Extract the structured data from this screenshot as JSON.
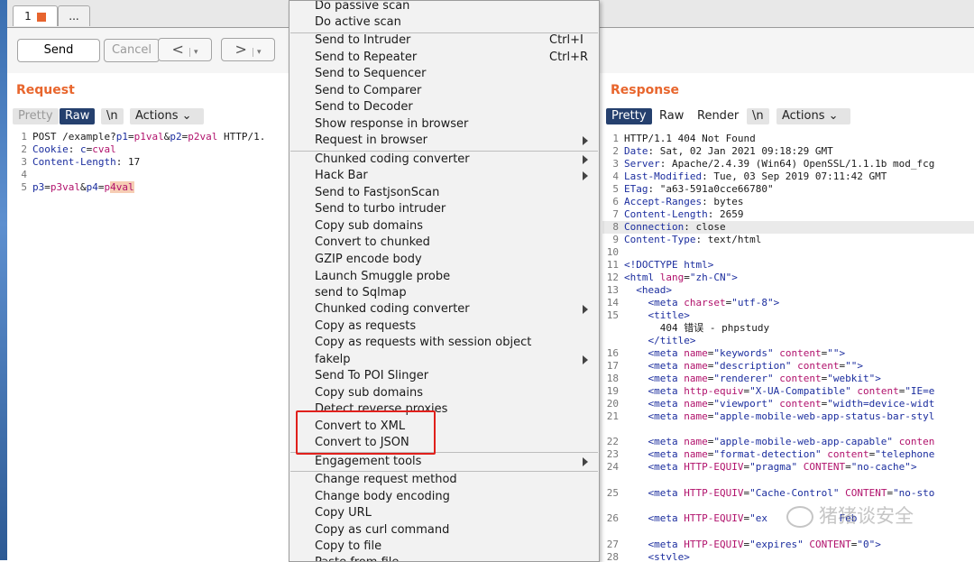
{
  "tabs": {
    "active": "1",
    "more": "..."
  },
  "toolbar": {
    "send": "Send",
    "cancel": "Cancel",
    "back": "<",
    "forward": ">",
    "dropdown": "▾"
  },
  "request": {
    "title": "Request",
    "views": [
      "Pretty",
      "Raw",
      "\\n"
    ],
    "actions": "Actions",
    "lines": [
      {
        "n": "1",
        "parts": [
          [
            "",
            "POST /example?"
          ],
          [
            "kw",
            "p1"
          ],
          [
            "",
            "="
          ],
          [
            "val",
            "p1val"
          ],
          [
            "",
            "&"
          ],
          [
            "kw",
            "p2"
          ],
          [
            "",
            "="
          ],
          [
            "val",
            "p2val"
          ],
          [
            "",
            " HTTP/1."
          ]
        ]
      },
      {
        "n": "2",
        "parts": [
          [
            "kw",
            "Cookie"
          ],
          [
            "",
            ": "
          ],
          [
            "kw",
            "c"
          ],
          [
            "",
            "="
          ],
          [
            "val",
            "cval"
          ]
        ]
      },
      {
        "n": "3",
        "parts": [
          [
            "kw",
            "Content-Length"
          ],
          [
            "",
            ": 17"
          ]
        ]
      },
      {
        "n": "4",
        "parts": []
      },
      {
        "n": "5",
        "parts": [
          [
            "kw",
            "p3"
          ],
          [
            "",
            "="
          ],
          [
            "val",
            "p3val"
          ],
          [
            "",
            "&"
          ],
          [
            "kw",
            "p4"
          ],
          [
            "",
            "="
          ],
          [
            "val",
            "p"
          ],
          [
            "val hl",
            "4val"
          ]
        ]
      }
    ]
  },
  "response": {
    "title": "Response",
    "views": [
      "Pretty",
      "Raw",
      "Render",
      "\\n"
    ],
    "actions": "Actions",
    "lines": [
      {
        "n": "1",
        "t": 147,
        "parts": [
          [
            "",
            "HTTP/1.1 404 Not Found"
          ]
        ]
      },
      {
        "n": "2",
        "t": 161,
        "parts": [
          [
            "kw",
            "Date"
          ],
          [
            "",
            ": Sat, 02 Jan 2021 09:18:29 GMT"
          ]
        ]
      },
      {
        "n": "3",
        "t": 175,
        "parts": [
          [
            "kw",
            "Server"
          ],
          [
            "",
            ": Apache/2.4.39 (Win64) OpenSSL/1.1.1b mod_fcg"
          ]
        ]
      },
      {
        "n": "4",
        "t": 189,
        "parts": [
          [
            "kw",
            "Last-Modified"
          ],
          [
            "",
            ": Tue, 03 Sep 2019 07:11:42 GMT"
          ]
        ]
      },
      {
        "n": "5",
        "t": 203,
        "parts": [
          [
            "kw",
            "ETag"
          ],
          [
            "",
            ": \"a63-591a0cce66780\""
          ]
        ]
      },
      {
        "n": "6",
        "t": 217,
        "parts": [
          [
            "kw",
            "Accept-Ranges"
          ],
          [
            "",
            ": bytes"
          ]
        ]
      },
      {
        "n": "7",
        "t": 231,
        "parts": [
          [
            "kw",
            "Content-Length"
          ],
          [
            "",
            ": 2659"
          ]
        ]
      },
      {
        "n": "8",
        "t": 245,
        "parts": [
          [
            "kw",
            "Connection"
          ],
          [
            "",
            ": close"
          ]
        ]
      },
      {
        "n": "9",
        "t": 259,
        "parts": [
          [
            "kw",
            "Content-Type"
          ],
          [
            "",
            ": text/html"
          ]
        ]
      },
      {
        "n": "10",
        "t": 273,
        "parts": []
      },
      {
        "n": "11",
        "t": 287,
        "parts": [
          [
            "tag",
            "<!DOCTYPE html>"
          ]
        ]
      },
      {
        "n": "12",
        "t": 301,
        "parts": [
          [
            "tag",
            "<html "
          ],
          [
            "attr",
            "lang"
          ],
          [
            "",
            "="
          ],
          [
            "str",
            "\"zh-CN\""
          ],
          [
            "tag",
            ">"
          ]
        ]
      },
      {
        "n": "13",
        "t": 315,
        "parts": [
          [
            "",
            "  "
          ],
          [
            "tag",
            "<head>"
          ]
        ]
      },
      {
        "n": "14",
        "t": 329,
        "parts": [
          [
            "",
            "    "
          ],
          [
            "tag",
            "<meta "
          ],
          [
            "attr",
            "charset"
          ],
          [
            "",
            "="
          ],
          [
            "str",
            "\"utf-8\""
          ],
          [
            "tag",
            ">"
          ]
        ]
      },
      {
        "n": "15",
        "t": 343,
        "parts": [
          [
            "",
            "    "
          ],
          [
            "tag",
            "<title>"
          ]
        ]
      },
      {
        "n": "",
        "t": 357,
        "parts": [
          [
            "",
            "      404 错误 - phpstudy"
          ]
        ]
      },
      {
        "n": "",
        "t": 371,
        "parts": [
          [
            "",
            "    "
          ],
          [
            "tag",
            "</title>"
          ]
        ]
      },
      {
        "n": "16",
        "t": 385,
        "parts": [
          [
            "",
            "    "
          ],
          [
            "tag",
            "<meta "
          ],
          [
            "attr",
            "name"
          ],
          [
            "",
            "="
          ],
          [
            "str",
            "\"keywords\""
          ],
          [
            "",
            " "
          ],
          [
            "attr",
            "content"
          ],
          [
            "",
            "="
          ],
          [
            "str",
            "\"\""
          ],
          [
            "tag",
            ">"
          ]
        ]
      },
      {
        "n": "17",
        "t": 399,
        "parts": [
          [
            "",
            "    "
          ],
          [
            "tag",
            "<meta "
          ],
          [
            "attr",
            "name"
          ],
          [
            "",
            "="
          ],
          [
            "str",
            "\"description\""
          ],
          [
            "",
            " "
          ],
          [
            "attr",
            "content"
          ],
          [
            "",
            "="
          ],
          [
            "str",
            "\"\""
          ],
          [
            "tag",
            ">"
          ]
        ]
      },
      {
        "n": "18",
        "t": 413,
        "parts": [
          [
            "",
            "    "
          ],
          [
            "tag",
            "<meta "
          ],
          [
            "attr",
            "name"
          ],
          [
            "",
            "="
          ],
          [
            "str",
            "\"renderer\""
          ],
          [
            "",
            " "
          ],
          [
            "attr",
            "content"
          ],
          [
            "",
            "="
          ],
          [
            "str",
            "\"webkit\""
          ],
          [
            "tag",
            ">"
          ]
        ]
      },
      {
        "n": "19",
        "t": 427,
        "parts": [
          [
            "",
            "    "
          ],
          [
            "tag",
            "<meta "
          ],
          [
            "attr",
            "http-equiv"
          ],
          [
            "",
            "="
          ],
          [
            "str",
            "\"X-UA-Compatible\""
          ],
          [
            "",
            " "
          ],
          [
            "attr",
            "content"
          ],
          [
            "",
            "="
          ],
          [
            "str",
            "\"IE=e"
          ]
        ]
      },
      {
        "n": "20",
        "t": 441,
        "parts": [
          [
            "",
            "    "
          ],
          [
            "tag",
            "<meta "
          ],
          [
            "attr",
            "name"
          ],
          [
            "",
            "="
          ],
          [
            "str",
            "\"viewport\""
          ],
          [
            "",
            " "
          ],
          [
            "attr",
            "content"
          ],
          [
            "",
            "="
          ],
          [
            "str",
            "\"width=device-widt"
          ]
        ]
      },
      {
        "n": "21",
        "t": 455,
        "parts": [
          [
            "",
            "    "
          ],
          [
            "tag",
            "<meta "
          ],
          [
            "attr",
            "name"
          ],
          [
            "",
            "="
          ],
          [
            "str",
            "\"apple-mobile-web-app-status-bar-styl"
          ]
        ]
      },
      {
        "n": "22",
        "t": 483,
        "parts": [
          [
            "",
            "    "
          ],
          [
            "tag",
            "<meta "
          ],
          [
            "attr",
            "name"
          ],
          [
            "",
            "="
          ],
          [
            "str",
            "\"apple-mobile-web-app-capable\""
          ],
          [
            "",
            " "
          ],
          [
            "attr",
            "conten"
          ]
        ]
      },
      {
        "n": "23",
        "t": 497,
        "parts": [
          [
            "",
            "    "
          ],
          [
            "tag",
            "<meta "
          ],
          [
            "attr",
            "name"
          ],
          [
            "",
            "="
          ],
          [
            "str",
            "\"format-detection\""
          ],
          [
            "",
            " "
          ],
          [
            "attr",
            "content"
          ],
          [
            "",
            "="
          ],
          [
            "str",
            "\"telephone"
          ]
        ]
      },
      {
        "n": "24",
        "t": 511,
        "parts": [
          [
            "",
            "    "
          ],
          [
            "tag",
            "<meta "
          ],
          [
            "attr",
            "HTTP-EQUIV"
          ],
          [
            "",
            "="
          ],
          [
            "str",
            "\"pragma\""
          ],
          [
            "",
            " "
          ],
          [
            "attr",
            "CONTENT"
          ],
          [
            "",
            "="
          ],
          [
            "str",
            "\"no-cache\""
          ],
          [
            "tag",
            ">"
          ]
        ]
      },
      {
        "n": "25",
        "t": 540,
        "parts": [
          [
            "",
            "    "
          ],
          [
            "tag",
            "<meta "
          ],
          [
            "attr",
            "HTTP-EQUIV"
          ],
          [
            "",
            "="
          ],
          [
            "str",
            "\"Cache-Control\""
          ],
          [
            "",
            " "
          ],
          [
            "attr",
            "CONTENT"
          ],
          [
            "",
            "="
          ],
          [
            "str",
            "\"no-sto"
          ]
        ]
      },
      {
        "n": "26",
        "t": 568,
        "parts": [
          [
            "",
            "    "
          ],
          [
            "tag",
            "<meta "
          ],
          [
            "attr",
            "HTTP-EQUIV"
          ],
          [
            "",
            "="
          ],
          [
            "str",
            "\"ex"
          ],
          [
            "",
            "            "
          ],
          [
            "str",
            "Feb"
          ]
        ]
      },
      {
        "n": "27",
        "t": 597,
        "parts": [
          [
            "",
            "    "
          ],
          [
            "tag",
            "<meta "
          ],
          [
            "attr",
            "HTTP-EQUIV"
          ],
          [
            "",
            "="
          ],
          [
            "str",
            "\"expires\""
          ],
          [
            "",
            " "
          ],
          [
            "attr",
            "CONTENT"
          ],
          [
            "",
            "="
          ],
          [
            "str",
            "\"0\""
          ],
          [
            "tag",
            ">"
          ]
        ]
      },
      {
        "n": "28",
        "t": 611,
        "parts": [
          [
            "",
            "    "
          ],
          [
            "tag",
            "<style>"
          ]
        ]
      }
    ]
  },
  "menu": {
    "items": [
      {
        "label": "Do passive scan",
        "t": -3
      },
      {
        "label": "Do active scan",
        "t": 15
      },
      {
        "sep": true,
        "t": 35
      },
      {
        "label": "Send to Intruder",
        "shortcut": "Ctrl+I",
        "t": 35
      },
      {
        "label": "Send to Repeater",
        "shortcut": "Ctrl+R",
        "t": 54
      },
      {
        "label": "Send to Sequencer",
        "t": 72
      },
      {
        "label": "Send to Comparer",
        "t": 91
      },
      {
        "label": "Send to Decoder",
        "t": 109
      },
      {
        "label": "Show response in browser",
        "t": 128
      },
      {
        "label": "Request in browser",
        "submenu": true,
        "t": 146
      },
      {
        "sep": true,
        "t": 166
      },
      {
        "label": "Chunked coding converter",
        "submenu": true,
        "t": 167
      },
      {
        "label": "Hack Bar",
        "submenu": true,
        "t": 185
      },
      {
        "label": "Send to FastjsonScan",
        "t": 204
      },
      {
        "label": "Send to turbo intruder",
        "t": 222
      },
      {
        "label": "Copy sub domains",
        "t": 241
      },
      {
        "label": "Convert to chunked",
        "t": 259
      },
      {
        "label": "GZIP encode body",
        "t": 278
      },
      {
        "label": "Launch Smuggle probe",
        "t": 297
      },
      {
        "label": "send to Sqlmap",
        "t": 315
      },
      {
        "label": "Chunked coding converter",
        "submenu": true,
        "t": 333
      },
      {
        "label": "Copy as requests",
        "t": 352
      },
      {
        "label": "Copy as requests with session object",
        "t": 370
      },
      {
        "label": "fakelp",
        "submenu": true,
        "t": 389
      },
      {
        "label": "Send To POI Slinger",
        "t": 407
      },
      {
        "label": "Copy sub domains",
        "t": 426
      },
      {
        "label": "Detect reverse proxies",
        "t": 444
      },
      {
        "label": "Convert to XML",
        "t": 463
      },
      {
        "label": "Convert to JSON",
        "t": 481
      },
      {
        "sep": true,
        "t": 500
      },
      {
        "label": "Engagement tools",
        "submenu": true,
        "t": 502
      },
      {
        "sep": true,
        "t": 521
      },
      {
        "label": "Change request method",
        "t": 522
      },
      {
        "label": "Change body encoding",
        "t": 541
      },
      {
        "label": "Copy URL",
        "t": 559
      },
      {
        "label": "Copy as curl command",
        "t": 578
      },
      {
        "label": "Copy to file",
        "t": 596
      },
      {
        "label": "Paste from file",
        "t": 614
      }
    ]
  },
  "watermark": {
    "text": "猪猪谈安全"
  },
  "colors": {
    "accent": "#e8662d",
    "selected_view": "#25406e",
    "highlight_box": "#e0201c"
  }
}
